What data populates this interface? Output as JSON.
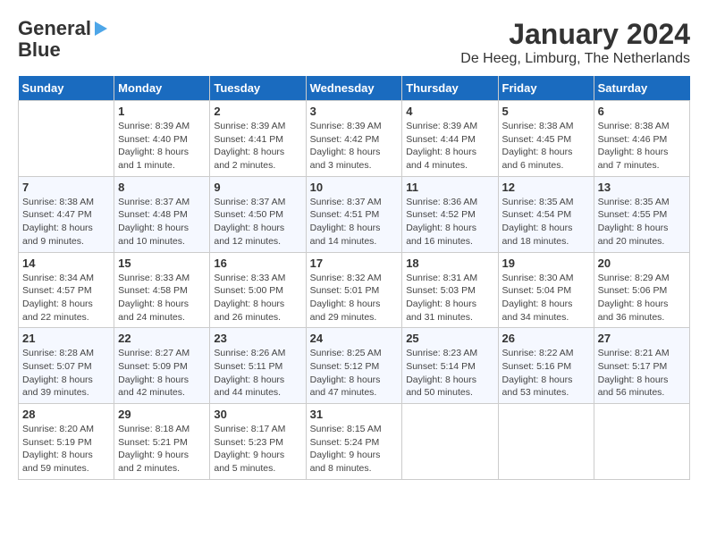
{
  "logo": {
    "line1": "General",
    "line2": "Blue"
  },
  "title": "January 2024",
  "location": "De Heeg, Limburg, The Netherlands",
  "headers": [
    "Sunday",
    "Monday",
    "Tuesday",
    "Wednesday",
    "Thursday",
    "Friday",
    "Saturday"
  ],
  "weeks": [
    [
      {
        "num": "",
        "info": ""
      },
      {
        "num": "1",
        "info": "Sunrise: 8:39 AM\nSunset: 4:40 PM\nDaylight: 8 hours\nand 1 minute."
      },
      {
        "num": "2",
        "info": "Sunrise: 8:39 AM\nSunset: 4:41 PM\nDaylight: 8 hours\nand 2 minutes."
      },
      {
        "num": "3",
        "info": "Sunrise: 8:39 AM\nSunset: 4:42 PM\nDaylight: 8 hours\nand 3 minutes."
      },
      {
        "num": "4",
        "info": "Sunrise: 8:39 AM\nSunset: 4:44 PM\nDaylight: 8 hours\nand 4 minutes."
      },
      {
        "num": "5",
        "info": "Sunrise: 8:38 AM\nSunset: 4:45 PM\nDaylight: 8 hours\nand 6 minutes."
      },
      {
        "num": "6",
        "info": "Sunrise: 8:38 AM\nSunset: 4:46 PM\nDaylight: 8 hours\nand 7 minutes."
      }
    ],
    [
      {
        "num": "7",
        "info": "Sunrise: 8:38 AM\nSunset: 4:47 PM\nDaylight: 8 hours\nand 9 minutes."
      },
      {
        "num": "8",
        "info": "Sunrise: 8:37 AM\nSunset: 4:48 PM\nDaylight: 8 hours\nand 10 minutes."
      },
      {
        "num": "9",
        "info": "Sunrise: 8:37 AM\nSunset: 4:50 PM\nDaylight: 8 hours\nand 12 minutes."
      },
      {
        "num": "10",
        "info": "Sunrise: 8:37 AM\nSunset: 4:51 PM\nDaylight: 8 hours\nand 14 minutes."
      },
      {
        "num": "11",
        "info": "Sunrise: 8:36 AM\nSunset: 4:52 PM\nDaylight: 8 hours\nand 16 minutes."
      },
      {
        "num": "12",
        "info": "Sunrise: 8:35 AM\nSunset: 4:54 PM\nDaylight: 8 hours\nand 18 minutes."
      },
      {
        "num": "13",
        "info": "Sunrise: 8:35 AM\nSunset: 4:55 PM\nDaylight: 8 hours\nand 20 minutes."
      }
    ],
    [
      {
        "num": "14",
        "info": "Sunrise: 8:34 AM\nSunset: 4:57 PM\nDaylight: 8 hours\nand 22 minutes."
      },
      {
        "num": "15",
        "info": "Sunrise: 8:33 AM\nSunset: 4:58 PM\nDaylight: 8 hours\nand 24 minutes."
      },
      {
        "num": "16",
        "info": "Sunrise: 8:33 AM\nSunset: 5:00 PM\nDaylight: 8 hours\nand 26 minutes."
      },
      {
        "num": "17",
        "info": "Sunrise: 8:32 AM\nSunset: 5:01 PM\nDaylight: 8 hours\nand 29 minutes."
      },
      {
        "num": "18",
        "info": "Sunrise: 8:31 AM\nSunset: 5:03 PM\nDaylight: 8 hours\nand 31 minutes."
      },
      {
        "num": "19",
        "info": "Sunrise: 8:30 AM\nSunset: 5:04 PM\nDaylight: 8 hours\nand 34 minutes."
      },
      {
        "num": "20",
        "info": "Sunrise: 8:29 AM\nSunset: 5:06 PM\nDaylight: 8 hours\nand 36 minutes."
      }
    ],
    [
      {
        "num": "21",
        "info": "Sunrise: 8:28 AM\nSunset: 5:07 PM\nDaylight: 8 hours\nand 39 minutes."
      },
      {
        "num": "22",
        "info": "Sunrise: 8:27 AM\nSunset: 5:09 PM\nDaylight: 8 hours\nand 42 minutes."
      },
      {
        "num": "23",
        "info": "Sunrise: 8:26 AM\nSunset: 5:11 PM\nDaylight: 8 hours\nand 44 minutes."
      },
      {
        "num": "24",
        "info": "Sunrise: 8:25 AM\nSunset: 5:12 PM\nDaylight: 8 hours\nand 47 minutes."
      },
      {
        "num": "25",
        "info": "Sunrise: 8:23 AM\nSunset: 5:14 PM\nDaylight: 8 hours\nand 50 minutes."
      },
      {
        "num": "26",
        "info": "Sunrise: 8:22 AM\nSunset: 5:16 PM\nDaylight: 8 hours\nand 53 minutes."
      },
      {
        "num": "27",
        "info": "Sunrise: 8:21 AM\nSunset: 5:17 PM\nDaylight: 8 hours\nand 56 minutes."
      }
    ],
    [
      {
        "num": "28",
        "info": "Sunrise: 8:20 AM\nSunset: 5:19 PM\nDaylight: 8 hours\nand 59 minutes."
      },
      {
        "num": "29",
        "info": "Sunrise: 8:18 AM\nSunset: 5:21 PM\nDaylight: 9 hours\nand 2 minutes."
      },
      {
        "num": "30",
        "info": "Sunrise: 8:17 AM\nSunset: 5:23 PM\nDaylight: 9 hours\nand 5 minutes."
      },
      {
        "num": "31",
        "info": "Sunrise: 8:15 AM\nSunset: 5:24 PM\nDaylight: 9 hours\nand 8 minutes."
      },
      {
        "num": "",
        "info": ""
      },
      {
        "num": "",
        "info": ""
      },
      {
        "num": "",
        "info": ""
      }
    ]
  ]
}
